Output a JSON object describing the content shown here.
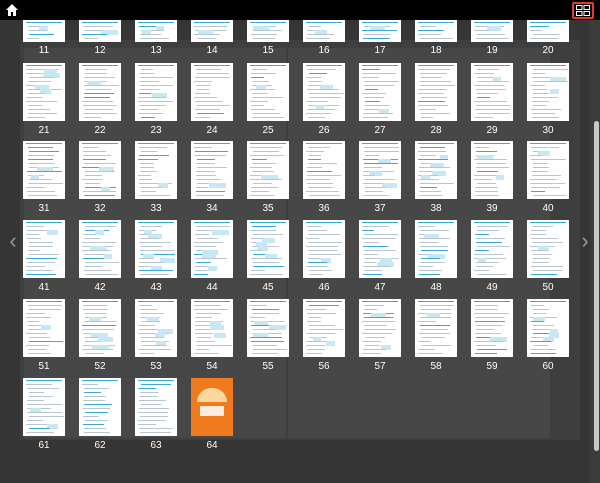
{
  "toolbar": {
    "home_icon": "home-icon",
    "grid_icon": "thumbnail-grid-icon",
    "accent": "#e23b2e"
  },
  "nav": {
    "prev": "‹",
    "next": "›"
  },
  "thumbnails": {
    "row0": [
      "11",
      "12",
      "13",
      "14",
      "15",
      "16",
      "17",
      "18",
      "19",
      "20"
    ],
    "row1": [
      "21",
      "22",
      "23",
      "24",
      "25",
      "26",
      "27",
      "28",
      "29",
      "30"
    ],
    "row2": [
      "31",
      "32",
      "33",
      "34",
      "35",
      "36",
      "37",
      "38",
      "39",
      "40"
    ],
    "row3": [
      "41",
      "42",
      "43",
      "44",
      "45",
      "46",
      "47",
      "48",
      "49",
      "50"
    ],
    "row4": [
      "51",
      "52",
      "53",
      "54",
      "55",
      "56",
      "57",
      "58",
      "59",
      "60"
    ],
    "row5": [
      "61",
      "62",
      "63",
      "64"
    ]
  }
}
